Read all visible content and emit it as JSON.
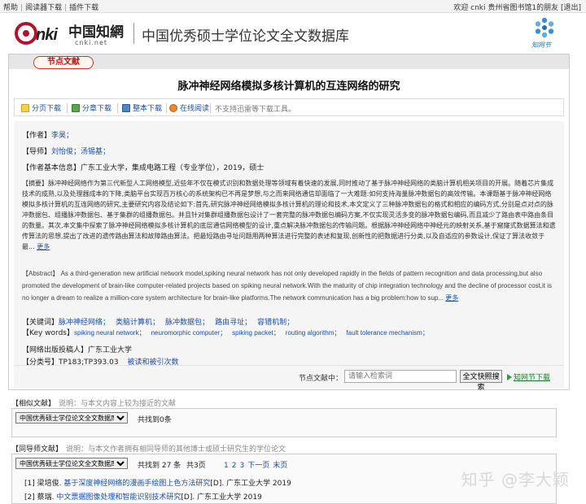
{
  "topbar": {
    "left_links": [
      "帮助",
      "阅读器下载",
      "插件下载"
    ],
    "right_text": "欢迎  cnki 贵州省图书馆1的朋友",
    "exit": "[退出]"
  },
  "header": {
    "logo_cnki": "cnki",
    "logo_cn_name": "中国知網",
    "logo_site": "cnki.net",
    "title": "中国优秀硕士学位论文全文数据库",
    "corner_logo_label": "知网节"
  },
  "main": {
    "tab_label": "节点文献",
    "paper_title": "脉冲神经网络模拟多核计算机的互连网络的研究",
    "downloads": [
      {
        "label": "分页下载",
        "icon": "page-download-icon",
        "color": "#f4d24a"
      },
      {
        "label": "分章下载",
        "icon": "chapter-download-icon",
        "color": "#58a84a"
      },
      {
        "label": "整本下载",
        "icon": "full-download-icon",
        "color": "#4b86c8"
      },
      {
        "label": "在线阅读",
        "icon": "online-read-icon",
        "color": "#e8892e"
      }
    ],
    "downloads_note": "不支持迅雷等下载工具。",
    "author_label": "【作者】",
    "author": "李昊；",
    "advisor_label": "【导师】",
    "advisors": [
      "刘怡俊；",
      "汤锡基；"
    ],
    "author_info_label": "【作者基本信息】",
    "author_info": "广东工业大学，集成电路工程（专业学位），2019，硕士",
    "abstract_label": "【摘要】",
    "abstract_cn": "脉冲神经网络作为第三代新型人工网络模型,近些年不仅在模式识别和数据处理等领域有着快速的发展,同时推动了基于脉冲神经网络的类脑计算机相关项目的开展。随着芯片集成技术的成熟,以及处理器成本的下降,类脑平台实现百万核心的系统架构已不再是梦想,与之而来网络通信却面临了一大难题:如何支持海量脉冲数据包的高效传输。本课题基于脉冲神经网络模拟多核计算机的互连网络的研究,主要研究内容及结论如下:首先,研究脉冲神经网络模拟多核计算机的理论和技术,本文定义了三种脉冲数据包的格式和相应的编码方式,分别是点对点的脉冲数据包、组播脉冲数据包、基于集群的组播数据包。并且针对集群组播数据包设计了一套完整的脉冲数据包编码方案,不仅实现灵活多变的脉冲数据包编码,而且减少了路由表中路由条目的数量。其次,本文集中探索了脉冲神经网络模拟多核计算机的底层通信网络模型的设计,重点解决脉冲数据包的传输问题。根据脉冲神经网络中神经元的映射关系,基于窟窿式数据算法和遗传算法的思想,提出了改进的遗传路由算法和故障路由算法。把最短路由寻址问题用两种算法进行完整的表述和复现,创新性的把数据进行分类,以及自适应的参数设计,保证了算法收敛于最...",
    "more_cn": "更多",
    "abstract_en_label": "【Abstract】",
    "abstract_en": "As a third-generation new artificial network model,spiking neural network has not only developed rapidly in the fields of pattern recognition and data processing,but also promoted the development of brain-like computer-related projects based on spiking neural network.With the maturity of chip integration technology and the decline of processor cost,it is no longer a dream to realize a million-core system architecture for brain-like platforms.The network communication has a big problem:how to sup...",
    "more_en": "更多",
    "keywords_label": "【关键词】",
    "keywords_cn": [
      "脉冲神经网络；",
      "类脑计算机；",
      "脉冲数据包；",
      "路由寻址；",
      "容错机制；"
    ],
    "keywords_en_label": "【Key words】",
    "keywords_en": [
      "spiking neural network；",
      "neuromorphic computer；",
      "spiking packet；",
      "routing algorithm；",
      "fault tolerance mechanism；"
    ],
    "unit_label": "【网络出版投稿人】",
    "unit": "广东工业大学",
    "class_label": "【分类号】",
    "class_no": "TP183;TP393.03",
    "download_stats": "被读和被引次数",
    "inner_search_label": "节点文献中：",
    "inner_search_placeholder": "请输入检索词",
    "inner_search_button": "全文快照搜索",
    "knode_link": "知网节下载"
  },
  "similar": {
    "title": "【相似文献】",
    "note": "说明：与本文内容上较为接近的文献",
    "db_select": "中国优秀硕士学位论文全文数据库",
    "count": "共找到0条"
  },
  "same_advisor": {
    "title": "【同导师文献】",
    "note": "说明：与本文作者拥有相同导师的其他博士或硕士研究生的学位论文",
    "db_select": "中国优秀硕士学位论文全文数据库",
    "count": "共找到 27 条",
    "pages": "共3页",
    "page_links": [
      "1",
      "2",
      "3",
      "下一页",
      "末页"
    ],
    "refs": [
      {
        "num": "[1]",
        "author": "梁培俊.",
        "title": "基于深度神经网络的漫画手绘图上色方法研究",
        "source": "[D]. 广东工业大学 2019"
      },
      {
        "num": "[2]",
        "author": "蔡瑞.",
        "title": "中文票据图像处理和智能识别技术研究",
        "source": "[D]. 广东工业大学 2019"
      }
    ]
  },
  "watermark": "知乎 @李大颖"
}
